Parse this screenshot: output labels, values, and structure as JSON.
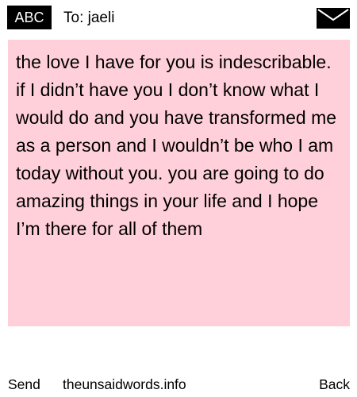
{
  "header": {
    "input_mode_label": "ABC",
    "to_label": "To: jaeli",
    "envelope_icon": "envelope-icon"
  },
  "message": {
    "body": "the love I have for you is indescribable. if I didn’t have you I don’t know what I would do and you have transformed me as a person and I wouldn’t be who I am today without you. you are going to do amazing things in your life and I hope I’m there for all of them",
    "background_color": "#ffd0d9"
  },
  "softkeys": {
    "send_label": "Send",
    "site_label": "theunsaidwords.info",
    "back_label": "Back"
  },
  "colors": {
    "badge_background": "#000000",
    "badge_text": "#ffffff",
    "text": "#000000"
  }
}
